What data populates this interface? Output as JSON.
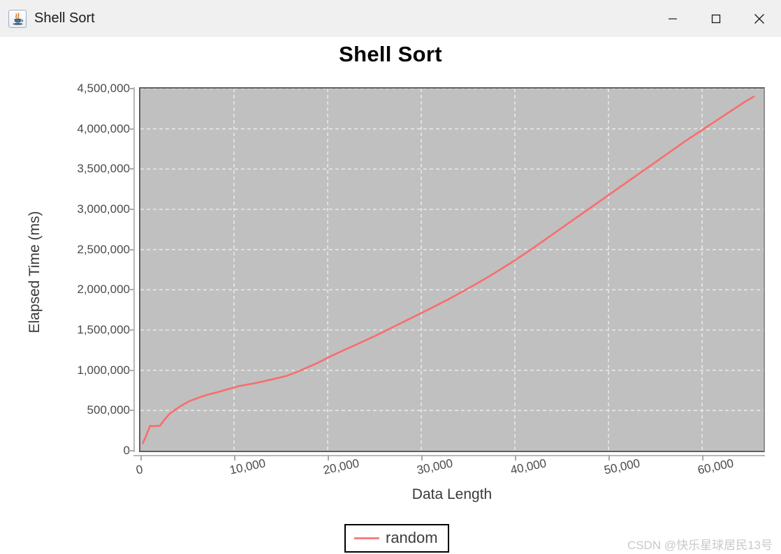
{
  "window": {
    "title": "Shell Sort",
    "icon": "java-coffee-cup-icon",
    "controls": {
      "minimize": "—",
      "maximize": "☐",
      "close": "✕"
    }
  },
  "watermark": "CSDN @快乐星球居民13号",
  "colors": {
    "line": "#f96d6d",
    "legend_line": "#f98080",
    "plot_background": "#c0c0c0",
    "gridline": "#e8e8e8",
    "titlebar": "#f0f0f0",
    "axis_text": "#4a4a4a"
  },
  "chart_data": {
    "type": "line",
    "title": "Shell Sort",
    "xlabel": "Data Length",
    "ylabel": "Elapsed Time (ms)",
    "xlim": [
      0,
      66560
    ],
    "ylim": [
      0,
      4500000
    ],
    "grid": true,
    "legend_position": "bottom-center",
    "xticks": [
      0,
      10000,
      20000,
      30000,
      40000,
      50000,
      60000
    ],
    "xtick_labels": [
      "0",
      "10,000",
      "20,000",
      "30,000",
      "40,000",
      "50,000",
      "60,000"
    ],
    "yticks": [
      0,
      500000,
      1000000,
      1500000,
      2000000,
      2500000,
      3000000,
      3500000,
      4000000,
      4500000
    ],
    "ytick_labels": [
      "0",
      "500,000",
      "1,000,000",
      "1,500,000",
      "2,000,000",
      "2,500,000",
      "3,000,000",
      "3,500,000",
      "4,000,000",
      "4,500,000"
    ],
    "series": [
      {
        "name": "random",
        "color": "#f96d6d",
        "x": [
          260,
          520,
          1040,
          1300,
          2080,
          2600,
          3120,
          4160,
          5200,
          6240,
          7280,
          8320,
          9360,
          10400,
          12480,
          14560,
          15600,
          16640,
          18720,
          20800,
          22880,
          24960,
          26000,
          27040,
          29120,
          31200,
          33280,
          35360,
          37440,
          39520,
          41600,
          43680,
          45760,
          47840,
          49920,
          52000,
          54080,
          56160,
          58240,
          60320,
          62400,
          64480,
          65520
        ],
        "y": [
          95000,
          160000,
          310000,
          305000,
          310000,
          390000,
          460000,
          545000,
          615000,
          660000,
          700000,
          730000,
          765000,
          800000,
          845000,
          900000,
          930000,
          975000,
          1080000,
          1200000,
          1310000,
          1420000,
          1480000,
          1540000,
          1660000,
          1780000,
          1905000,
          2040000,
          2180000,
          2330000,
          2490000,
          2660000,
          2830000,
          3000000,
          3170000,
          3340000,
          3510000,
          3680000,
          3850000,
          4010000,
          4170000,
          4330000,
          4400000
        ]
      }
    ]
  },
  "legend": {
    "entries": [
      {
        "label": "random"
      }
    ]
  }
}
